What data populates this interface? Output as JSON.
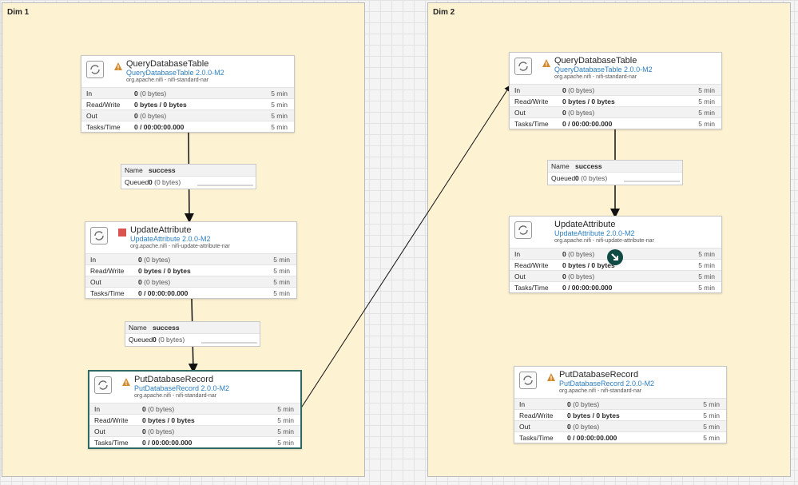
{
  "groups": [
    {
      "title": "Dim 1"
    },
    {
      "title": "Dim 2"
    }
  ],
  "stat_labels": {
    "in": "In",
    "rw": "Read/Write",
    "out": "Out",
    "tasks": "Tasks/Time"
  },
  "connection_labels": {
    "name": "Name",
    "queued": "Queued"
  },
  "processors": {
    "d1_query": {
      "name": "QueryDatabaseTable",
      "type": "QueryDatabaseTable 2.0.0-M2",
      "bundle": "org.apache.nifi - nifi-standard-nar",
      "status": "warning-icon",
      "in_count": "0",
      "in_bytes": "(0 bytes)",
      "rw": "0 bytes / 0 bytes",
      "out_count": "0",
      "out_bytes": "(0 bytes)",
      "tasks": "0 / 00:00:00.000",
      "window": "5 min"
    },
    "d1_update": {
      "name": "UpdateAttribute",
      "type": "UpdateAttribute 2.0.0-M2",
      "bundle": "org.apache.nifi - nifi-update-attribute-nar",
      "status": "stopped-icon",
      "in_count": "0",
      "in_bytes": "(0 bytes)",
      "rw": "0 bytes / 0 bytes",
      "out_count": "0",
      "out_bytes": "(0 bytes)",
      "tasks": "0 / 00:00:00.000",
      "window": "5 min"
    },
    "d1_put": {
      "name": "PutDatabaseRecord",
      "type": "PutDatabaseRecord 2.0.0-M2",
      "bundle": "org.apache.nifi - nifi-standard-nar",
      "status": "warning-icon",
      "in_count": "0",
      "in_bytes": "(0 bytes)",
      "rw": "0 bytes / 0 bytes",
      "out_count": "0",
      "out_bytes": "(0 bytes)",
      "tasks": "0 / 00:00:00.000",
      "window": "5 min"
    },
    "d2_query": {
      "name": "QueryDatabaseTable",
      "type": "QueryDatabaseTable 2.0.0-M2",
      "bundle": "org.apache.nifi - nifi-standard-nar",
      "status": "warning-icon",
      "in_count": "0",
      "in_bytes": "(0 bytes)",
      "rw": "0 bytes / 0 bytes",
      "out_count": "0",
      "out_bytes": "(0 bytes)",
      "tasks": "0 / 00:00:00.000",
      "window": "5 min"
    },
    "d2_update": {
      "name": "UpdateAttribute",
      "type": "UpdateAttribute 2.0.0-M2",
      "bundle": "org.apache.nifi - nifi-update-attribute-nar",
      "status": "none",
      "in_count": "0",
      "in_bytes": "(0 bytes)",
      "rw": "0 bytes / 0 bytes",
      "out_count": "0",
      "out_bytes": "(0 bytes)",
      "tasks": "0 / 00:00:00.000",
      "window": "5 min"
    },
    "d2_put": {
      "name": "PutDatabaseRecord",
      "type": "PutDatabaseRecord 2.0.0-M2",
      "bundle": "org.apache.nifi - nifi-standard-nar",
      "status": "warning-icon",
      "in_count": "0",
      "in_bytes": "(0 bytes)",
      "rw": "0 bytes / 0 bytes",
      "out_count": "0",
      "out_bytes": "(0 bytes)",
      "tasks": "0 / 00:00:00.000",
      "window": "5 min"
    }
  },
  "connections": {
    "d1_c1": {
      "name": "success",
      "queued_count": "0",
      "queued_bytes": "(0 bytes)"
    },
    "d1_c2": {
      "name": "success",
      "queued_count": "0",
      "queued_bytes": "(0 bytes)"
    },
    "d2_c1": {
      "name": "success",
      "queued_count": "0",
      "queued_bytes": "(0 bytes)"
    }
  },
  "colors": {
    "group_bg": "#fdf3d3",
    "link": "#2d7fc1",
    "warning": "#d28a2e",
    "stopped": "#d9534f",
    "selected_border": "#2f6b63"
  }
}
